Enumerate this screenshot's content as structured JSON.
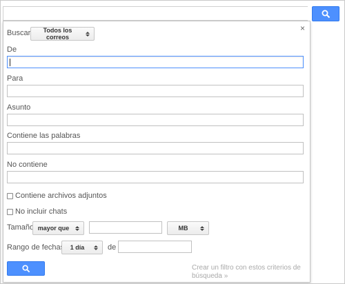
{
  "search_panel": {
    "search_label": "Buscar",
    "search_scope": "Todos los correos",
    "close_glyph": "×",
    "from_label": "De",
    "to_label": "Para",
    "subject_label": "Asunto",
    "has_words_label": "Contiene las palabras",
    "doesnt_have_label": "No contiene",
    "has_attachment_label": "Contiene archivos adjuntos",
    "no_chats_label": "No incluir chats",
    "size_label": "Tamaño",
    "size_operator": "mayor que",
    "size_value": "",
    "size_unit": "MB",
    "date_range_label": "Rango de fechas",
    "date_range_value": "1 día",
    "date_of_label": "de",
    "create_filter_link": "Crear un filtro con estos criterios de búsqueda »"
  },
  "colors": {
    "primary_button": "#4d90fe",
    "focus_border": "#4d90fe",
    "link_disabled": "#a9a9a9"
  },
  "icons": {
    "search": "search-icon",
    "close": "close-icon"
  }
}
